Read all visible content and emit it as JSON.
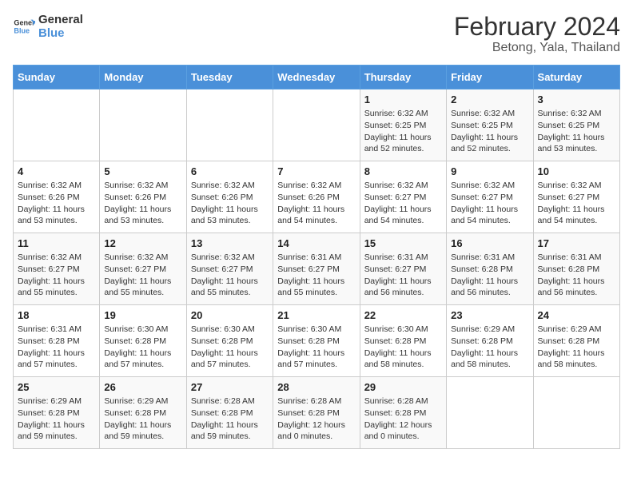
{
  "logo": {
    "text_general": "General",
    "text_blue": "Blue"
  },
  "title": "February 2024",
  "subtitle": "Betong, Yala, Thailand",
  "days_of_week": [
    "Sunday",
    "Monday",
    "Tuesday",
    "Wednesday",
    "Thursday",
    "Friday",
    "Saturday"
  ],
  "weeks": [
    [
      {
        "day": "",
        "info": ""
      },
      {
        "day": "",
        "info": ""
      },
      {
        "day": "",
        "info": ""
      },
      {
        "day": "",
        "info": ""
      },
      {
        "day": "1",
        "info": "Sunrise: 6:32 AM\nSunset: 6:25 PM\nDaylight: 11 hours\nand 52 minutes."
      },
      {
        "day": "2",
        "info": "Sunrise: 6:32 AM\nSunset: 6:25 PM\nDaylight: 11 hours\nand 52 minutes."
      },
      {
        "day": "3",
        "info": "Sunrise: 6:32 AM\nSunset: 6:25 PM\nDaylight: 11 hours\nand 53 minutes."
      }
    ],
    [
      {
        "day": "4",
        "info": "Sunrise: 6:32 AM\nSunset: 6:26 PM\nDaylight: 11 hours\nand 53 minutes."
      },
      {
        "day": "5",
        "info": "Sunrise: 6:32 AM\nSunset: 6:26 PM\nDaylight: 11 hours\nand 53 minutes."
      },
      {
        "day": "6",
        "info": "Sunrise: 6:32 AM\nSunset: 6:26 PM\nDaylight: 11 hours\nand 53 minutes."
      },
      {
        "day": "7",
        "info": "Sunrise: 6:32 AM\nSunset: 6:26 PM\nDaylight: 11 hours\nand 54 minutes."
      },
      {
        "day": "8",
        "info": "Sunrise: 6:32 AM\nSunset: 6:27 PM\nDaylight: 11 hours\nand 54 minutes."
      },
      {
        "day": "9",
        "info": "Sunrise: 6:32 AM\nSunset: 6:27 PM\nDaylight: 11 hours\nand 54 minutes."
      },
      {
        "day": "10",
        "info": "Sunrise: 6:32 AM\nSunset: 6:27 PM\nDaylight: 11 hours\nand 54 minutes."
      }
    ],
    [
      {
        "day": "11",
        "info": "Sunrise: 6:32 AM\nSunset: 6:27 PM\nDaylight: 11 hours\nand 55 minutes."
      },
      {
        "day": "12",
        "info": "Sunrise: 6:32 AM\nSunset: 6:27 PM\nDaylight: 11 hours\nand 55 minutes."
      },
      {
        "day": "13",
        "info": "Sunrise: 6:32 AM\nSunset: 6:27 PM\nDaylight: 11 hours\nand 55 minutes."
      },
      {
        "day": "14",
        "info": "Sunrise: 6:31 AM\nSunset: 6:27 PM\nDaylight: 11 hours\nand 55 minutes."
      },
      {
        "day": "15",
        "info": "Sunrise: 6:31 AM\nSunset: 6:27 PM\nDaylight: 11 hours\nand 56 minutes."
      },
      {
        "day": "16",
        "info": "Sunrise: 6:31 AM\nSunset: 6:28 PM\nDaylight: 11 hours\nand 56 minutes."
      },
      {
        "day": "17",
        "info": "Sunrise: 6:31 AM\nSunset: 6:28 PM\nDaylight: 11 hours\nand 56 minutes."
      }
    ],
    [
      {
        "day": "18",
        "info": "Sunrise: 6:31 AM\nSunset: 6:28 PM\nDaylight: 11 hours\nand 57 minutes."
      },
      {
        "day": "19",
        "info": "Sunrise: 6:30 AM\nSunset: 6:28 PM\nDaylight: 11 hours\nand 57 minutes."
      },
      {
        "day": "20",
        "info": "Sunrise: 6:30 AM\nSunset: 6:28 PM\nDaylight: 11 hours\nand 57 minutes."
      },
      {
        "day": "21",
        "info": "Sunrise: 6:30 AM\nSunset: 6:28 PM\nDaylight: 11 hours\nand 57 minutes."
      },
      {
        "day": "22",
        "info": "Sunrise: 6:30 AM\nSunset: 6:28 PM\nDaylight: 11 hours\nand 58 minutes."
      },
      {
        "day": "23",
        "info": "Sunrise: 6:29 AM\nSunset: 6:28 PM\nDaylight: 11 hours\nand 58 minutes."
      },
      {
        "day": "24",
        "info": "Sunrise: 6:29 AM\nSunset: 6:28 PM\nDaylight: 11 hours\nand 58 minutes."
      }
    ],
    [
      {
        "day": "25",
        "info": "Sunrise: 6:29 AM\nSunset: 6:28 PM\nDaylight: 11 hours\nand 59 minutes."
      },
      {
        "day": "26",
        "info": "Sunrise: 6:29 AM\nSunset: 6:28 PM\nDaylight: 11 hours\nand 59 minutes."
      },
      {
        "day": "27",
        "info": "Sunrise: 6:28 AM\nSunset: 6:28 PM\nDaylight: 11 hours\nand 59 minutes."
      },
      {
        "day": "28",
        "info": "Sunrise: 6:28 AM\nSunset: 6:28 PM\nDaylight: 12 hours\nand 0 minutes."
      },
      {
        "day": "29",
        "info": "Sunrise: 6:28 AM\nSunset: 6:28 PM\nDaylight: 12 hours\nand 0 minutes."
      },
      {
        "day": "",
        "info": ""
      },
      {
        "day": "",
        "info": ""
      }
    ]
  ]
}
